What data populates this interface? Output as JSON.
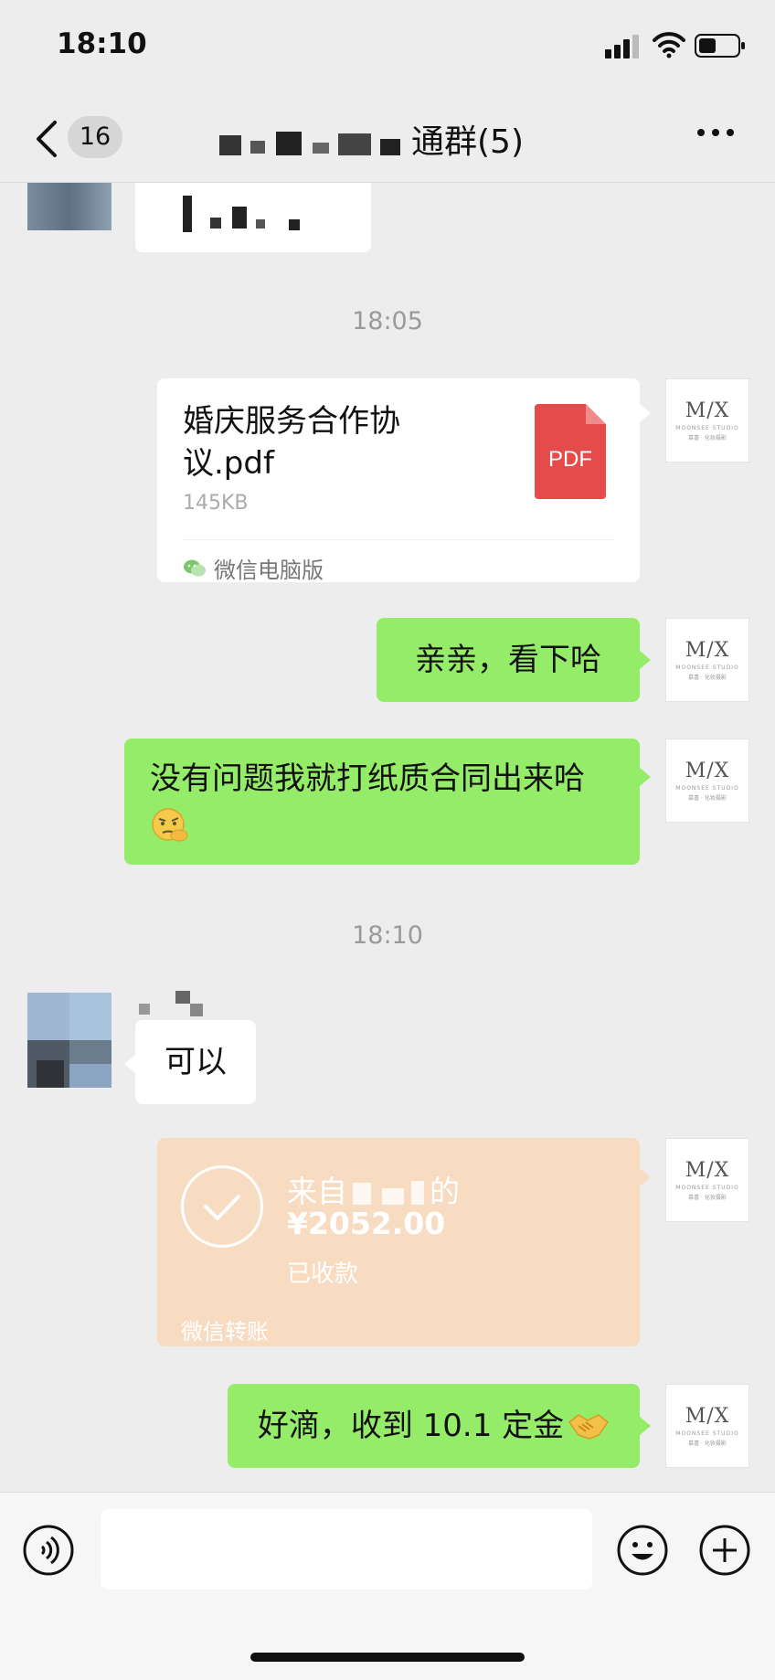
{
  "status": {
    "time": "18:10"
  },
  "nav": {
    "back_count": "16",
    "title": "通群(5)"
  },
  "messages": {
    "ts1": "18:05",
    "file": {
      "name": "婚庆服务合作协议.pdf",
      "size": "145KB",
      "icon_label": "PDF",
      "source": "微信电脑版"
    },
    "msg1": "亲亲，看下哈",
    "msg2": "没有问题我就打纸质合同出来哈",
    "ts2": "18:10",
    "reply": "可以",
    "transfer": {
      "from": "来自",
      "from_suffix": "的",
      "amount": "¥2052.00",
      "status": "已收款",
      "type": "微信转账"
    },
    "msg3": "好滴，收到 10.1 定金"
  },
  "avatar_me": {
    "logo": "M/X",
    "studio": "MOONSEE STUDIO",
    "studio_cn": "慕喜 · 化妆摄影"
  },
  "icons": {
    "back": "chevron-left-icon",
    "more": "more-icon",
    "pdf": "pdf-file-icon",
    "wechat": "wechat-icon",
    "voice": "voice-icon",
    "emoji": "emoji-icon",
    "plus": "plus-icon",
    "check": "check-circle-icon",
    "handshake": "handshake-emoji",
    "thinking": "thinking-emoji"
  },
  "colors": {
    "green_bubble": "#95ec69",
    "transfer": "#f8dcc2",
    "pdf_red": "#e54b4b",
    "bg": "#ededed"
  }
}
